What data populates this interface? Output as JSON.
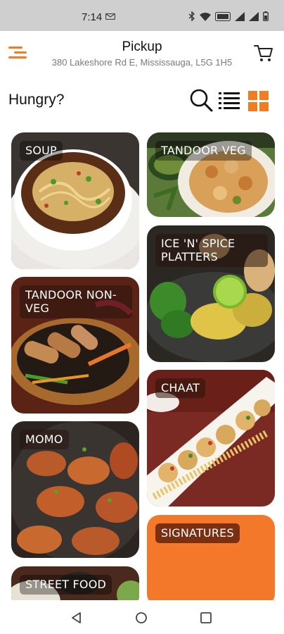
{
  "status_bar": {
    "time": "7:14",
    "icons": [
      "message-icon",
      "bluetooth-icon",
      "wifi-icon",
      "volte-icon",
      "signal-icon",
      "signal-icon",
      "battery-icon"
    ]
  },
  "header": {
    "title": "Pickup",
    "address": "380 Lakeshore Rd E, Mississauga, L5G 1H5",
    "menu_icon": "menu-icon",
    "cart_icon": "cart-icon"
  },
  "toolbar": {
    "greeting": "Hungry?",
    "search_icon": "search-icon",
    "list_view_icon": "list-view-icon",
    "grid_view_icon": "grid-view-icon"
  },
  "categories": [
    {
      "label": "SOUP"
    },
    {
      "label": "TANDOOR VEG"
    },
    {
      "label": "ICE 'N' SPICE PLATTERS"
    },
    {
      "label": "TANDOOR NON-VEG"
    },
    {
      "label": "CHAAT"
    },
    {
      "label": "MOMO"
    },
    {
      "label": "SIGNATURES"
    },
    {
      "label": "STREET FOOD"
    }
  ],
  "colors": {
    "accent": "#f47b20",
    "signatures_bg": "#f4782a",
    "status_bar": "#cfcfcf"
  },
  "nav_bar": {
    "back_icon": "back-icon",
    "home_icon": "home-icon",
    "recents_icon": "recents-icon"
  }
}
